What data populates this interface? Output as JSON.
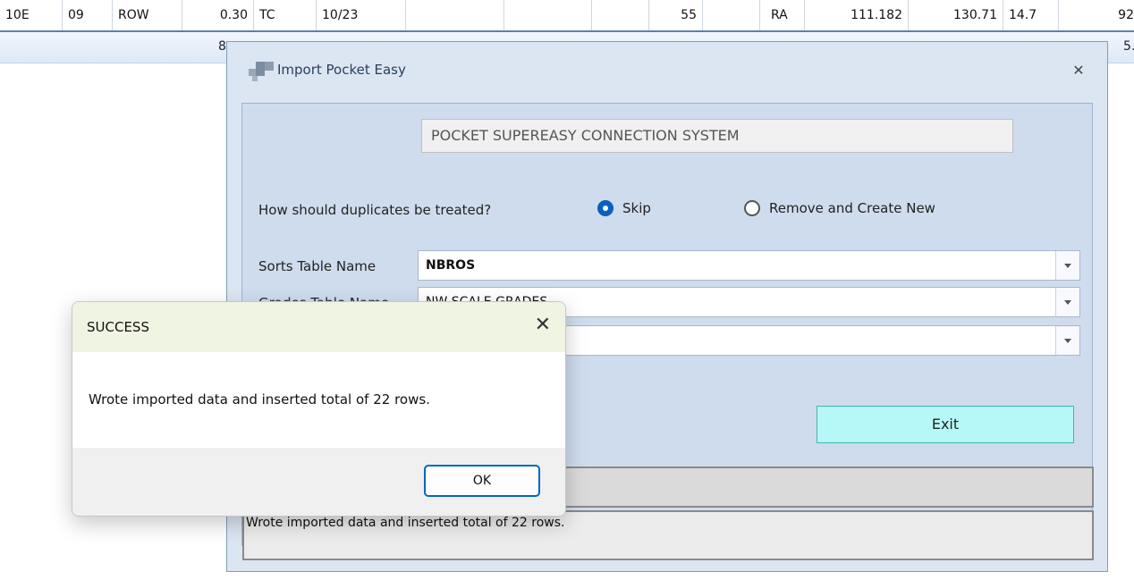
{
  "grid": {
    "row": [
      "10E",
      "09",
      "ROW",
      "0.30",
      "TC",
      "10/23",
      "",
      "",
      "",
      "55",
      "",
      "RA",
      "111.182",
      "130.71",
      "14.7",
      "92"
    ],
    "footer_left": "8",
    "footer_right": "5…"
  },
  "import_window": {
    "title": "Import Pocket Easy",
    "system_title": "POCKET SUPEREASY CONNECTION SYSTEM",
    "duplicates_question": "How should duplicates be treated?",
    "option_skip": "Skip",
    "option_remove": "Remove and Create New",
    "selected_option": "Skip",
    "sorts_label": "Sorts Table Name",
    "sorts_value": "NBROS",
    "grades_label": "Grades Table Name",
    "grades_value": "NW SCALE GRADES",
    "third_value": "",
    "exit_label": "Exit",
    "log_text": "Wrote imported data and inserted total of 22 rows."
  },
  "message_box": {
    "title": "SUCCESS",
    "message": "Wrote imported data and inserted total of 22 rows.",
    "ok_label": "OK"
  },
  "colors": {
    "accent": "#0067c0",
    "exit_button": "#b6f7f7",
    "window_background": "#dce6f2"
  }
}
